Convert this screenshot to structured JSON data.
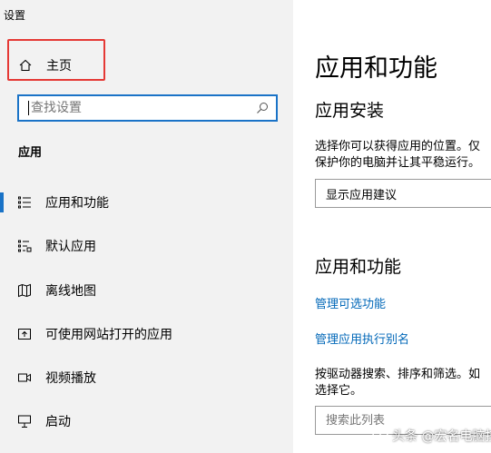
{
  "window": {
    "title": "设置"
  },
  "sidebar": {
    "home_label": "主页",
    "search_placeholder": "查找设置",
    "section_label": "应用",
    "items": [
      {
        "label": "应用和功能",
        "icon": "apps-list-icon",
        "active": true
      },
      {
        "label": "默认应用",
        "icon": "default-apps-icon",
        "active": false
      },
      {
        "label": "离线地图",
        "icon": "map-icon",
        "active": false
      },
      {
        "label": "可使用网站打开的应用",
        "icon": "open-with-site-icon",
        "active": false
      },
      {
        "label": "视频播放",
        "icon": "video-icon",
        "active": false
      },
      {
        "label": "启动",
        "icon": "startup-icon",
        "active": false
      }
    ]
  },
  "main": {
    "page_title": "应用和功能",
    "install_section": {
      "title": "应用安装",
      "desc_line1": "选择你可以获得应用的位置。仅",
      "desc_line2": "保护你的电脑并让其平稳运行。",
      "select_value": "显示应用建议"
    },
    "apps_section": {
      "title": "应用和功能",
      "link1": "管理可选功能",
      "link2": "管理应用执行别名",
      "desc_line1": "按驱动器搜索、排序和筛选。如",
      "desc_line2": "选择它。",
      "filter_placeholder": "搜索此列表"
    }
  },
  "watermark": {
    "text": "头条 @宏名电脑技术"
  },
  "colors": {
    "accent": "#1a73c7",
    "link": "#0067b8",
    "highlight": "#e53935",
    "sidebar_bg": "#f2f2f2"
  }
}
